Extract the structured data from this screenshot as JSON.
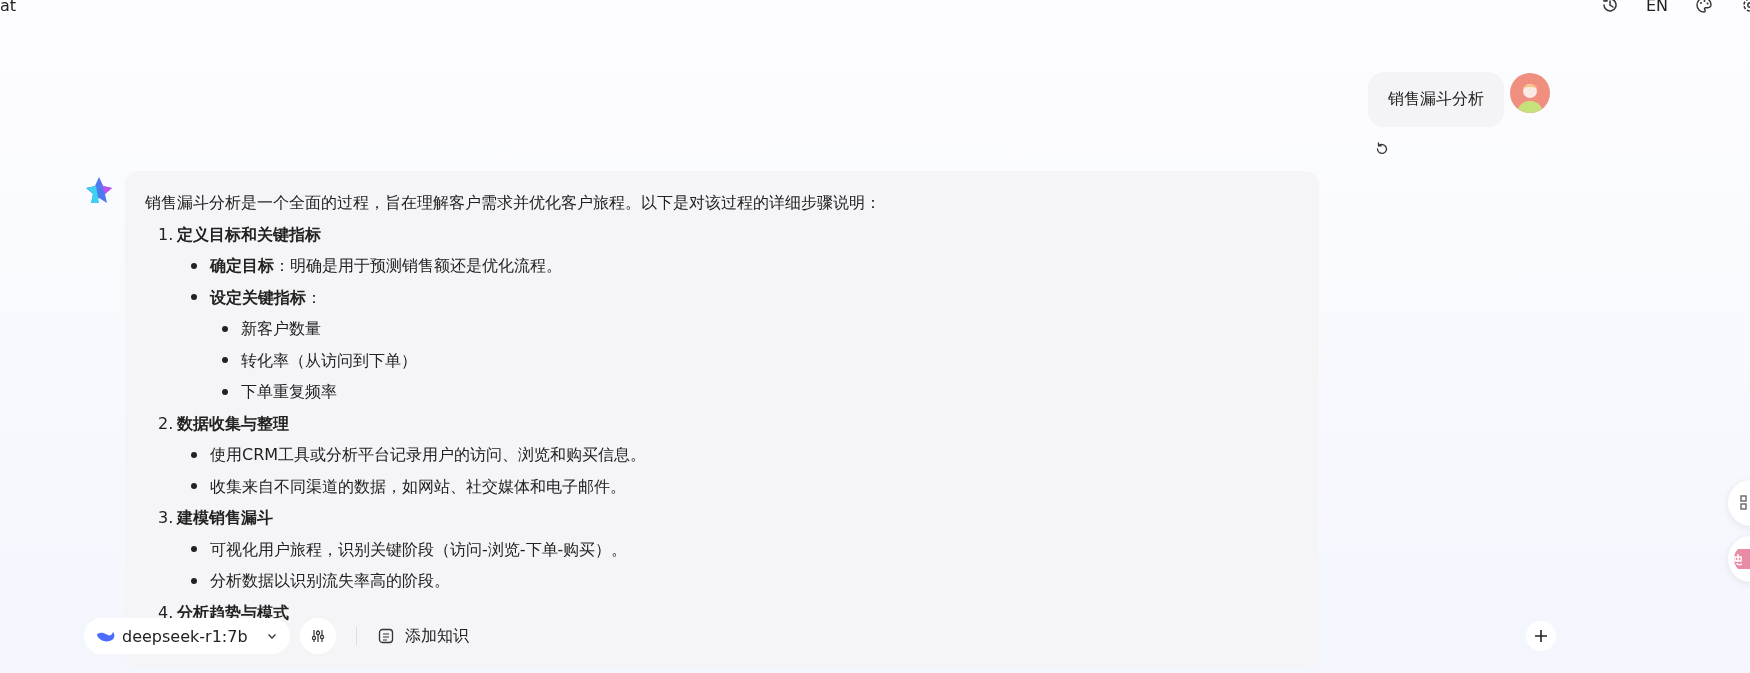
{
  "header": {
    "title": "at",
    "actions": [
      {
        "kind": "history"
      },
      {
        "kind": "language",
        "label": "EN"
      },
      {
        "kind": "theme"
      },
      {
        "kind": "settings"
      }
    ]
  },
  "user_message": {
    "text": "销售漏斗分析"
  },
  "answer": {
    "intro": "销售漏斗分析是一个全面的过程，旨在理解客户需求并优化客户旅程。以下是对该过程的详细步骤说明：",
    "steps": [
      {
        "number": "1.",
        "title": "定义目标和关键指标",
        "items": [
          {
            "text": "**确定目标**：明确是用于预测销售额还是优化流程。"
          },
          {
            "text": "**设定关键指标**：",
            "children": [
              {
                "text": "新客户数量"
              },
              {
                "text": "转化率（从访问到下单）"
              },
              {
                "text": "下单重复频率"
              }
            ]
          }
        ]
      },
      {
        "number": "2.",
        "title": "数据收集与整理",
        "items": [
          {
            "text": "使用CRM工具或分析平台记录用户的访问、浏览和购买信息。"
          },
          {
            "text": "收集来自不同渠道的数据，如网站、社交媒体和电子邮件。"
          }
        ]
      },
      {
        "number": "3.",
        "title": "建模销售漏斗",
        "items": [
          {
            "text": "可视化用户旅程，识别关键阶段（访问-浏览-下单-购买）。"
          },
          {
            "text": "分析数据以识别流失率高的阶段。"
          }
        ]
      },
      {
        "number": "4.",
        "title": "分析趋势与模式"
      }
    ]
  },
  "composer": {
    "model": {
      "label": "deepseek-r1:7b"
    },
    "knowledge_button": {
      "label": "添加知识"
    }
  }
}
